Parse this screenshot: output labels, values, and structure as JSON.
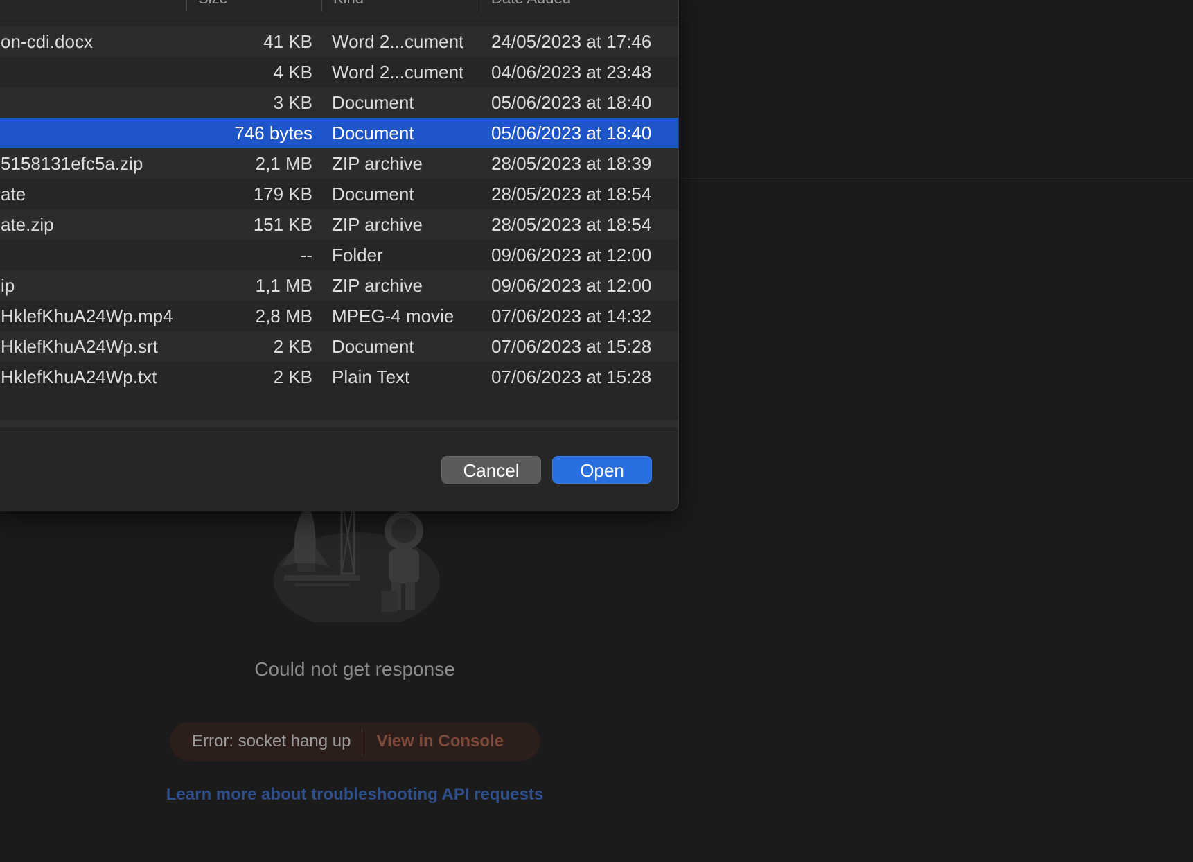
{
  "dialog": {
    "columns": {
      "size": "Size",
      "kind": "Kind",
      "date": "Date Added"
    },
    "files": [
      {
        "name": "on-cdi.docx",
        "size": "41 KB",
        "kind": "Word 2...cument",
        "date": "24/05/2023 at 17:46"
      },
      {
        "name": "",
        "size": "4 KB",
        "kind": "Word 2...cument",
        "date": "04/06/2023 at 23:48"
      },
      {
        "name": "",
        "size": "3 KB",
        "kind": "Document",
        "date": "05/06/2023 at 18:40"
      },
      {
        "name": "",
        "size": "746 bytes",
        "kind": "Document",
        "date": "05/06/2023 at 18:40"
      },
      {
        "name": "5158131efc5a.zip",
        "size": "2,1 MB",
        "kind": "ZIP archive",
        "date": "28/05/2023 at 18:39"
      },
      {
        "name": "ate",
        "size": "179 KB",
        "kind": "Document",
        "date": "28/05/2023 at 18:54"
      },
      {
        "name": "ate.zip",
        "size": "151 KB",
        "kind": "ZIP archive",
        "date": "28/05/2023 at 18:54"
      },
      {
        "name": "",
        "size": "--",
        "kind": "Folder",
        "date": "09/06/2023 at 12:00"
      },
      {
        "name": "ip",
        "size": "1,1 MB",
        "kind": "ZIP archive",
        "date": "09/06/2023 at 12:00"
      },
      {
        "name": "HklefKhuA24Wp.mp4",
        "size": "2,8 MB",
        "kind": "MPEG-4 movie",
        "date": "07/06/2023 at 14:32"
      },
      {
        "name": "HklefKhuA24Wp.srt",
        "size": "2 KB",
        "kind": "Document",
        "date": "07/06/2023 at 15:28"
      },
      {
        "name": "HklefKhuA24Wp.txt",
        "size": "2 KB",
        "kind": "Plain Text",
        "date": "07/06/2023 at 15:28"
      }
    ],
    "selected_index": 3,
    "cancel_label": "Cancel",
    "open_label": "Open"
  },
  "background": {
    "error_title": "Could not get response",
    "error_message": "Error: socket hang up",
    "view_console_label": "View in Console",
    "learn_more_link": "Learn more about troubleshooting API requests"
  },
  "colors": {
    "selection": "#1e56c9",
    "open_button": "#2a6fe0",
    "error_accent": "#7e4a3a",
    "link": "#2f4f8a"
  }
}
